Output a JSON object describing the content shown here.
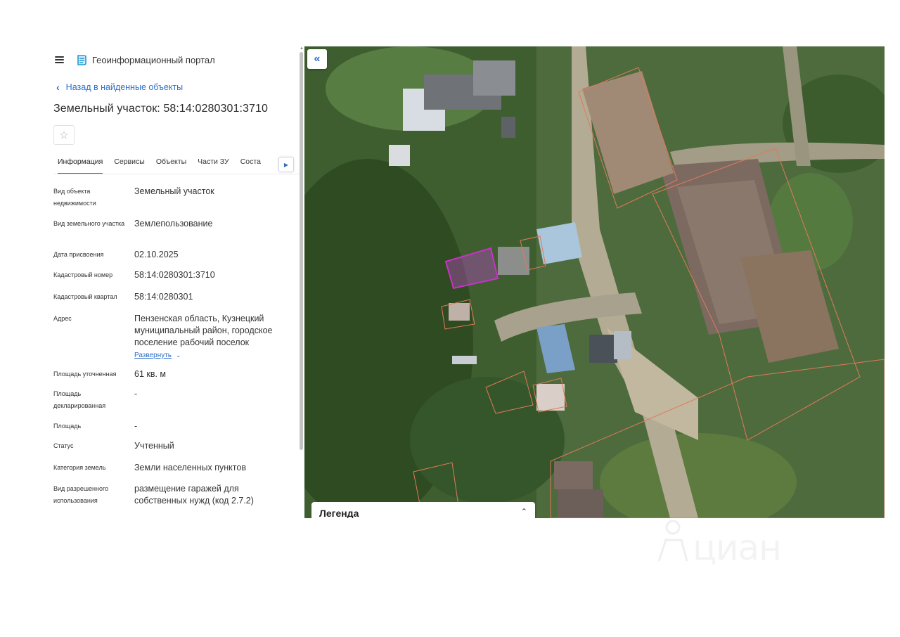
{
  "header": {
    "app_title": "Геоинформационный портал",
    "back_link": "Назад в найденные объекты",
    "object_title": "Земельный участок: 58:14:0280301:3710"
  },
  "tabs": [
    {
      "label": "Информация",
      "active": true
    },
    {
      "label": "Сервисы"
    },
    {
      "label": "Объекты"
    },
    {
      "label": "Части ЗУ"
    },
    {
      "label": "Соста"
    }
  ],
  "info": {
    "object_type_label": "Вид объекта недвижимости",
    "object_type_value": "Земельный участок",
    "plot_type_label": "Вид земельного участка",
    "plot_type_value": "Землепользование",
    "assign_date_label": "Дата присвоения",
    "assign_date_value": "02.10.2025",
    "cad_number_label": "Кадастровый номер",
    "cad_number_value": "58:14:0280301:3710",
    "cad_quarter_label": "Кадастровый квартал",
    "cad_quarter_value": "58:14:0280301",
    "address_label": "Адрес",
    "address_value": "Пензенская область, Кузнецкий муниципальный район, городское поселение рабочий поселок",
    "expand_label": "Развернуть",
    "area_precise_label": "Площадь уточненная",
    "area_precise_value": "61 кв. м",
    "area_declared_label": "Площадь декларированная",
    "area_declared_value": "-",
    "area_label": "Площадь",
    "area_value": "-",
    "status_label": "Статус",
    "status_value": "Учтенный",
    "land_category_label": "Категория земель",
    "land_category_value": "Земли населенных пунктов",
    "permitted_use_label": "Вид разрешенного использования",
    "permitted_use_value": "размещение гаражей для собственных нужд (код 2.7.2)"
  },
  "map": {
    "collapse_label": "«",
    "legend_title": "Легенда"
  },
  "watermark": {
    "text": "циан"
  },
  "colors": {
    "accent": "#2f6fc9",
    "selected_parcel": "#c832c8",
    "parcel_outline": "#e07a5a"
  },
  "icons": {
    "menu": "hamburger-icon",
    "logo": "portal-logo-icon",
    "back": "chevron-left-icon",
    "favorite": "star-icon",
    "tab_scroll": "triangle-right-icon",
    "expand": "chevron-down-icon",
    "legend_toggle": "unfold-icon"
  }
}
